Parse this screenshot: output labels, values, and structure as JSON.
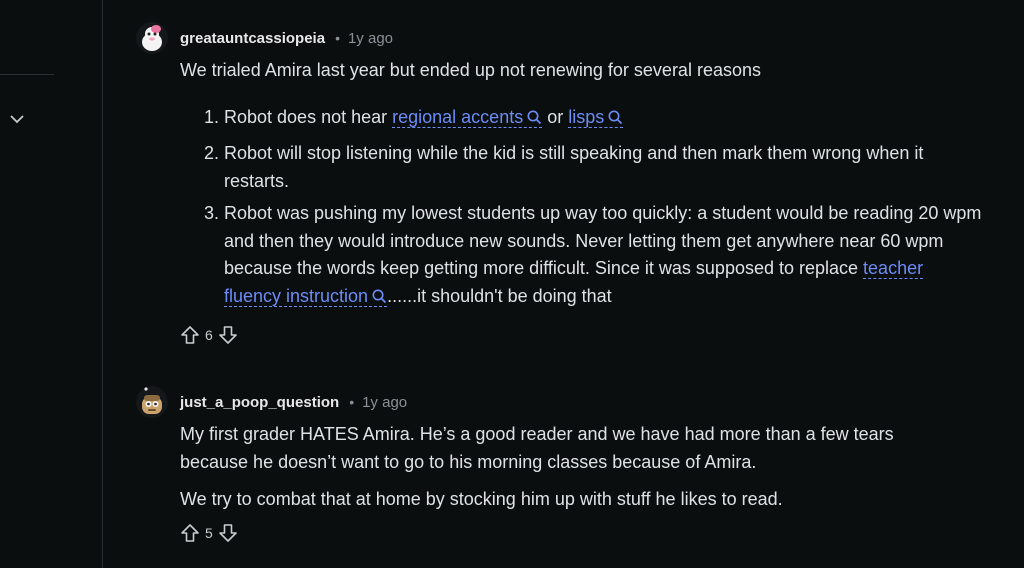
{
  "comments": [
    {
      "username": "greatauntcassiopeia",
      "time": "1y ago",
      "intro": "We trialed Amira last year but ended up not renewing for several reasons",
      "list": [
        {
          "num": "1.",
          "pre": "Robot does not hear ",
          "link1": "regional accents",
          "mid": " or ",
          "link2": "lisps"
        },
        {
          "num": "2.",
          "text": "Robot will stop listening while the kid is still speaking and then mark them wrong when it restarts."
        },
        {
          "num": "3.",
          "pre": "Robot was pushing my lowest students up way too quickly: a student would be reading 20 wpm and then they would introduce new sounds. Never letting them get anywhere near 60 wpm because the words keep getting more difficult. Since it was supposed to replace ",
          "link": "teacher fluency instruction",
          "post": "......it shouldn't be doing that"
        }
      ],
      "votes": "6"
    },
    {
      "username": "just_a_poop_question",
      "time": "1y ago",
      "para1": "My first grader HATES Amira. He’s a good reader and we have had more than a few tears because he doesn’t want to go to his morning classes because of Amira.",
      "para2": "We try to combat that at home by stocking him up with stuff he likes to read.",
      "votes": "5"
    }
  ],
  "icons": {
    "collapse": "chevron-down-icon",
    "upvote": "upvote-arrow-icon",
    "downvote": "downvote-arrow-icon",
    "search": "search-icon"
  },
  "colors": {
    "background": "#0b0e0f",
    "link": "#6c8cf6",
    "muted": "#8a9196"
  }
}
